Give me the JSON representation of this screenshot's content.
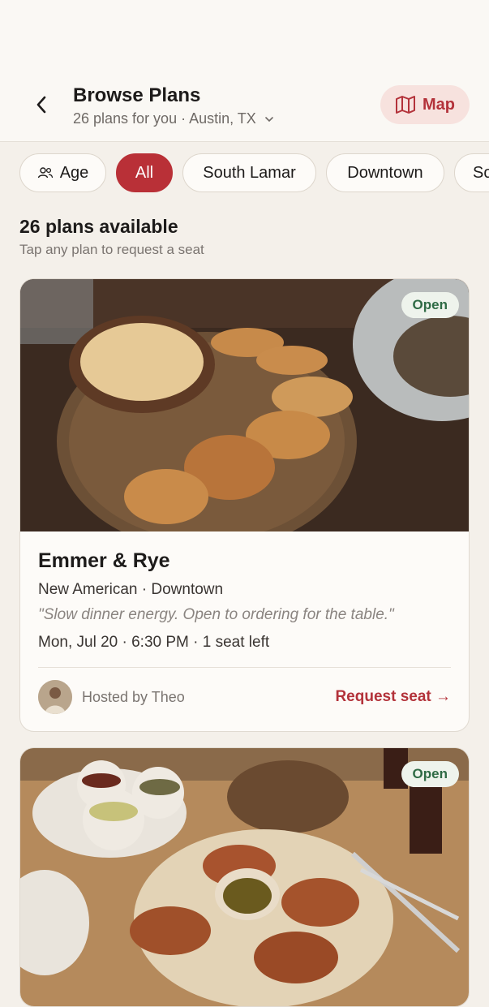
{
  "header": {
    "title": "Browse Plans",
    "subtitle": "26 plans for you · Austin, TX",
    "map_label": "Map"
  },
  "filters": [
    {
      "label": "Age",
      "icon": "people-icon",
      "active": false
    },
    {
      "label": "All",
      "active": true
    },
    {
      "label": "South Lamar",
      "active": false
    },
    {
      "label": "Downtown",
      "active": false
    },
    {
      "label": "So",
      "active": false
    }
  ],
  "section": {
    "title": "26 plans available",
    "subtitle": "Tap any plan to request a seat"
  },
  "plans": [
    {
      "badge": "Open",
      "venue": "Emmer & Rye",
      "cuisine": "New American · Downtown",
      "quote": "\"Slow dinner energy. Open to ordering for the table.\"",
      "when": "Mon, Jul 20 · 6:30 PM · 1 seat left",
      "host": "Hosted by Theo",
      "request_label": "Request seat →"
    },
    {
      "badge": "Open"
    }
  ],
  "colors": {
    "accent": "#b93037",
    "open_badge_bg": "#eef3ec",
    "open_badge_text": "#2f6b45",
    "background": "#f4f0ea"
  }
}
